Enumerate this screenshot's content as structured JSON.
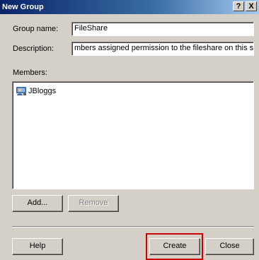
{
  "window": {
    "title": "New Group",
    "help_glyph": "?",
    "close_glyph": "X"
  },
  "form": {
    "group_name_label": "Group name:",
    "group_name_value": "FileShare",
    "description_label": "Description:",
    "description_value": "mbers assigned permission to the fileshare on this server",
    "members_label": "Members:"
  },
  "members": [
    {
      "name": "JBloggs",
      "icon": "user-icon"
    }
  ],
  "buttons": {
    "add": "Add...",
    "remove": "Remove",
    "help": "Help",
    "create": "Create",
    "close": "Close"
  },
  "colors": {
    "highlight": "#cc0000",
    "titlebar_start": "#0a246a",
    "titlebar_end": "#a6caf0"
  }
}
